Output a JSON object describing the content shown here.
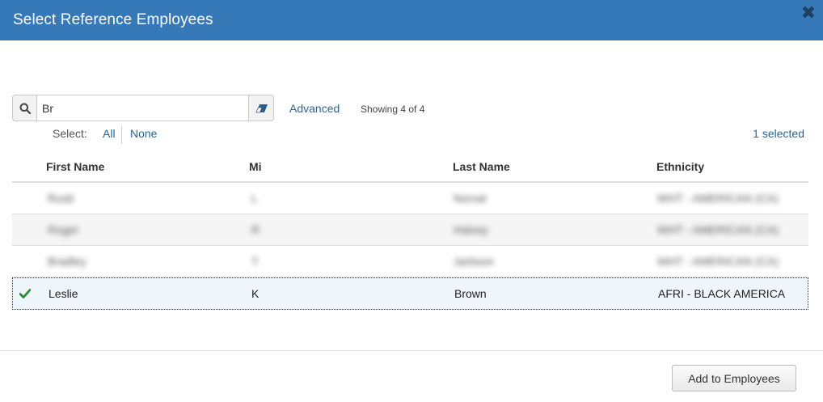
{
  "dialog": {
    "title": "Select Reference Employees",
    "close_glyph": "✖"
  },
  "search": {
    "value": "Br",
    "placeholder": "",
    "search_icon": "search-icon",
    "clear_icon": "eraser-icon"
  },
  "toolbar": {
    "advanced_label": "Advanced",
    "showing_text": "Showing 4 of 4",
    "select_label": "Select:",
    "select_all_label": "All",
    "select_none_label": "None",
    "selected_count": "1 selected"
  },
  "table": {
    "columns": [
      "First Name",
      "Mi",
      "Last Name",
      "Ethnicity"
    ],
    "rows": [
      {
        "first": "Rusti",
        "mi": "L",
        "last": "Norval",
        "ethnicity": "WHT - AMERICAN (CA)",
        "obscured": true,
        "selected": false
      },
      {
        "first": "Roger",
        "mi": "R",
        "last": "Halvey",
        "ethnicity": "WHT - AMERICAN (CA)",
        "obscured": true,
        "selected": false
      },
      {
        "first": "Bradley",
        "mi": "T",
        "last": "Jarbson",
        "ethnicity": "WHT - AMERICAN (CA)",
        "obscured": true,
        "selected": false
      },
      {
        "first": "Leslie",
        "mi": "K",
        "last": "Brown",
        "ethnicity": "AFRI - BLACK AMERICA",
        "obscured": false,
        "selected": true
      }
    ]
  },
  "footer": {
    "add_button_label": "Add to Employees"
  },
  "colors": {
    "header_bg": "#3579b8",
    "link": "#2a6496",
    "check": "#2e8b2e",
    "selected_row_bg": "#eef6fb"
  }
}
